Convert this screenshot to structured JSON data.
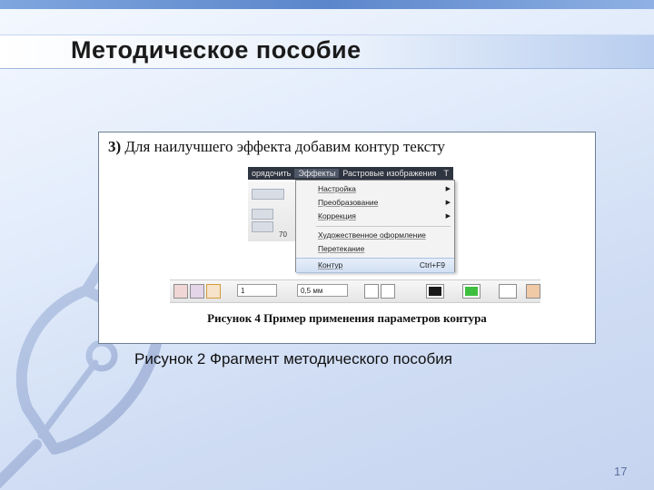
{
  "slide": {
    "title": "Методическое пособие",
    "caption": "Рисунок 2 Фрагмент методического пособия",
    "page_number": "17"
  },
  "figure": {
    "step_number": "3)",
    "step_text": "Для наилучшего эффекта добавим контур тексту",
    "caption": "Рисунок 4 Пример применения параметров контура",
    "menubar": [
      "орядочить",
      "Эффекты",
      "Растровые изображения",
      "Т"
    ],
    "menu_items": [
      {
        "label": "Настройка",
        "submenu": true
      },
      {
        "label": "Преобразование",
        "submenu": true
      },
      {
        "label": "Коррекция",
        "submenu": true
      },
      {
        "label": "Художественное оформление",
        "submenu": false
      },
      {
        "label": "Перетекание",
        "submenu": false
      },
      {
        "label": "Контур",
        "shortcut": "Ctrl+F9",
        "submenu": false
      }
    ],
    "ruler_value": "70",
    "propbar": {
      "steps_value": "1",
      "offset_value": "0,5 мм"
    },
    "colors": {
      "outline_color": "#1a1a1a",
      "fill_color": "#3fbf3f"
    }
  },
  "colors": {
    "title_band": "#b8cdef",
    "accent_top": "#5b86cb"
  },
  "icons": [
    "pen-nib-logo-icon",
    "arrow-right-icon",
    "spin-arrows-icon"
  ]
}
